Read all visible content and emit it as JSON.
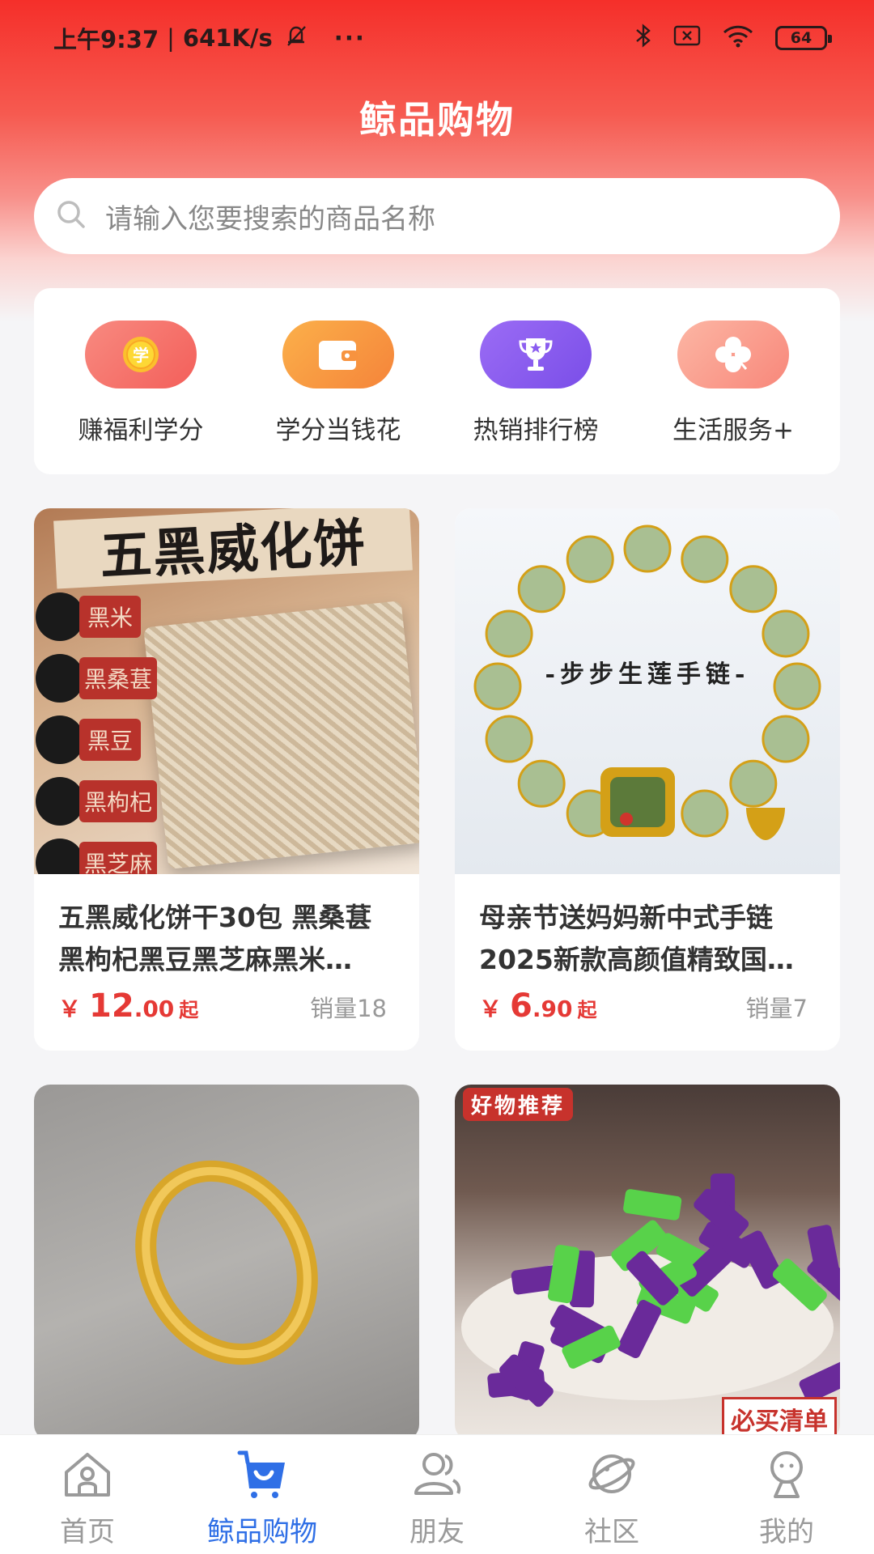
{
  "status_bar": {
    "time": "上午9:37",
    "speed": "641K/s",
    "more": "···",
    "battery": "64"
  },
  "header": {
    "title": "鲸品购物"
  },
  "search": {
    "placeholder": "请输入您要搜索的商品名称"
  },
  "quick_entries": [
    {
      "label": "赚福利学分",
      "icon": "coin-icon",
      "color": "#f6706a"
    },
    {
      "label": "学分当钱花",
      "icon": "wallet-icon",
      "color": "#f7933f"
    },
    {
      "label": "热销排行榜",
      "icon": "trophy-icon",
      "color": "#8a5cf0"
    },
    {
      "label": "生活服务+",
      "icon": "clover-icon",
      "color": "#f8a08c"
    }
  ],
  "products": [
    {
      "title": "五黑威化饼干30包 黑桑葚黑枸杞黑豆黑芝麻黑米…",
      "currency": "￥",
      "price_int": "12",
      "price_dec": ".00",
      "price_suffix": "起",
      "sales": "销量18",
      "banner": "五黑威化饼",
      "tags": [
        "黑米",
        "黑桑葚",
        "黑豆",
        "黑枸杞",
        "黑芝麻"
      ]
    },
    {
      "title": "母亲节送妈妈新中式手链2025新款高颜值精致国…",
      "currency": "￥",
      "price_int": "6",
      "price_dec": ".90",
      "price_suffix": "起",
      "sales": "销量7",
      "image_text": "-步步生莲手链-"
    },
    {
      "title": "",
      "image_text": ""
    },
    {
      "title": "",
      "badge": "好物推荐",
      "image_text": "必买清单"
    }
  ],
  "bottom_nav": [
    {
      "label": "首页",
      "icon": "home-icon",
      "active": false
    },
    {
      "label": "鲸品购物",
      "icon": "cart-icon",
      "active": true
    },
    {
      "label": "朋友",
      "icon": "friends-icon",
      "active": false
    },
    {
      "label": "社区",
      "icon": "planet-icon",
      "active": false
    },
    {
      "label": "我的",
      "icon": "profile-icon",
      "active": false
    }
  ],
  "colors": {
    "brand_red": "#f52f2a",
    "price_red": "#e53935",
    "nav_active": "#2f6fe6"
  }
}
